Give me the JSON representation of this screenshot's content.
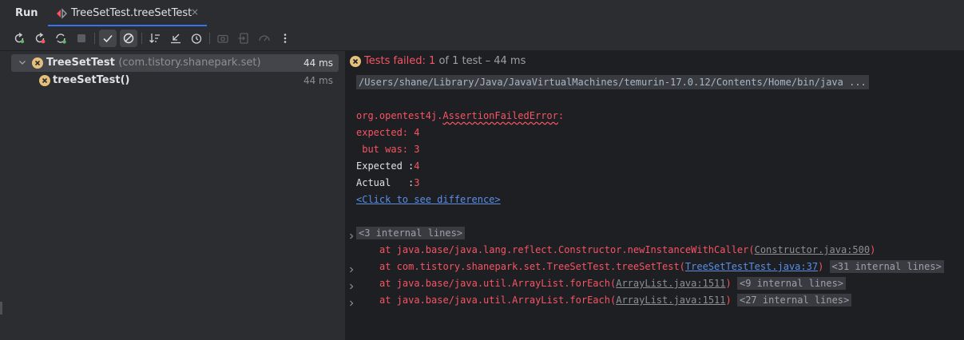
{
  "window": {
    "panel_title": "Run",
    "tab_label": "TreeSetTest.treeSetTest",
    "tab_close": "×"
  },
  "toolbar": {
    "items": [
      "rerun-icon",
      "rerun-failed-icon",
      "toggle-auto-test-icon",
      "stop-icon",
      "show-passed-icon",
      "show-ignored-icon",
      "sort-icon",
      "collapse-icon",
      "history-icon",
      "screenshot-icon",
      "export-icon",
      "profile-icon",
      "more-icon"
    ]
  },
  "tree": {
    "root": {
      "name": "TreeSetTest",
      "package": "(com.tistory.shanepark.set)",
      "time": "44 ms"
    },
    "child": {
      "name": "treeSetTest()",
      "time": "44 ms"
    }
  },
  "console": {
    "status_prefix": "Tests failed: ",
    "status_count": "1",
    "status_suffix": " of 1 test – 44 ms",
    "command": "/Users/shane/Library/Java/JavaVirtualMachines/temurin-17.0.12/Contents/Home/bin/java ...",
    "error_pkg": "org.opentest4j.",
    "error_class": "AssertionFailedError",
    "error_colon": ":",
    "expected_line": "expected: 4",
    "butwas_line": " but was: 3",
    "expected_label": "Expected :",
    "expected_value": "4",
    "actual_label": "Actual   :",
    "actual_value": "3",
    "diff_link": "<Click to see difference>",
    "fold1": "<3 internal lines>",
    "trace": [
      {
        "prefix": "at java.base/java.lang.reflect.Constructor.newInstanceWithCaller(",
        "link": "Constructor.java:500",
        "suffix": ")",
        "fold": ""
      },
      {
        "prefix": "at com.tistory.shanepark.set.TreeSetTest.treeSetTest(",
        "link": "TreeSetTestTest.java:37",
        "suffix": ")",
        "fold": "<31 internal lines>"
      },
      {
        "prefix": "at java.base/java.util.ArrayList.forEach(",
        "link": "ArrayList.java:1511",
        "suffix": ")",
        "fold": "<9 internal lines>"
      },
      {
        "prefix": "at java.base/java.util.ArrayList.forEach(",
        "link": "ArrayList.java:1511",
        "suffix": ")",
        "fold": "<27 internal lines>"
      }
    ]
  },
  "colors": {
    "accent": "#3574f0",
    "error": "#f75464",
    "warning_icon": "#e5c07b",
    "link": "#5c8ee6"
  }
}
